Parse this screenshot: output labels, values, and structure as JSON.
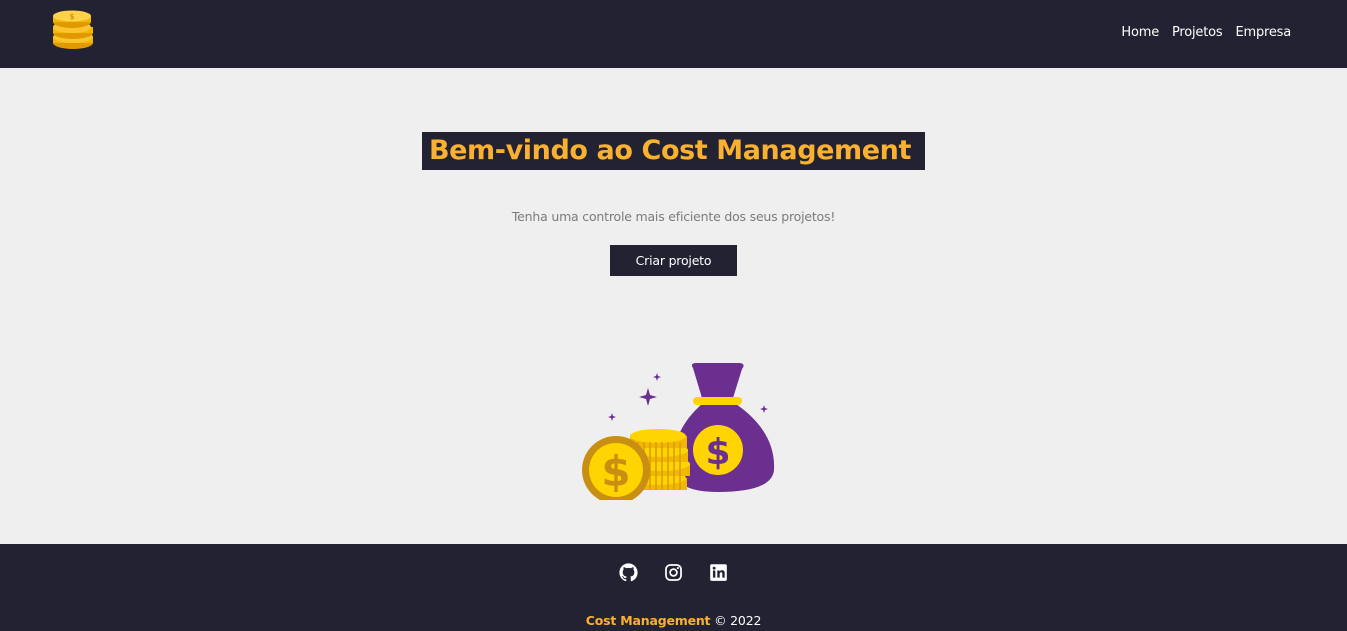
{
  "navbar": {
    "logo_icon": "coins-stack-icon",
    "links": [
      {
        "label": "Home"
      },
      {
        "label": "Projetos"
      },
      {
        "label": "Empresa"
      }
    ]
  },
  "hero": {
    "title_prefix": "Bem-vindo ao ",
    "title_brand": "Cost Management",
    "subtitle": "Tenha uma controle mais eficiente dos seus projetos!",
    "button_label": "Criar projeto",
    "illustration": "money-bag-and-coins-illustration"
  },
  "footer": {
    "social_icons": [
      "github-icon",
      "instagram-icon",
      "linkedin-icon"
    ],
    "brand": "Cost Management",
    "copyright": "© 2022"
  },
  "colors": {
    "dark": "#222233",
    "accent": "#fbb130",
    "background": "#efefef",
    "purple": "#6a2f8f",
    "gold": "#ffd400"
  }
}
